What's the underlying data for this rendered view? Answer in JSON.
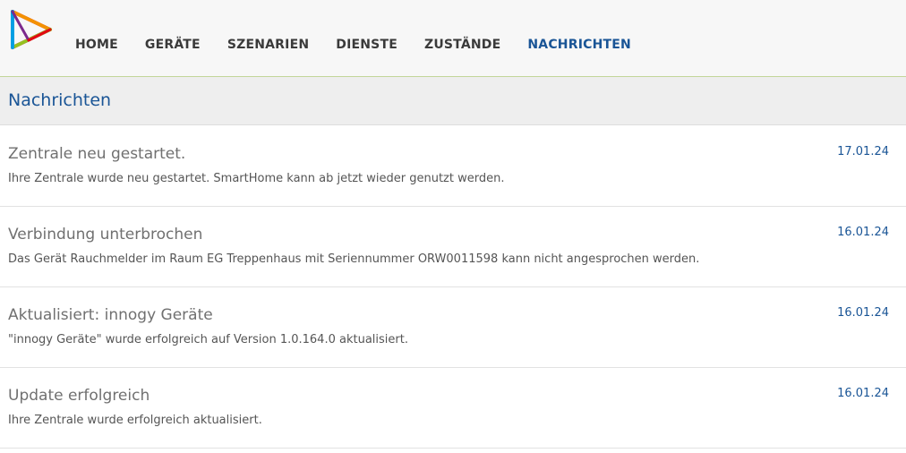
{
  "nav": {
    "items": [
      {
        "label": "HOME",
        "active": false
      },
      {
        "label": "GERÄTE",
        "active": false
      },
      {
        "label": "SZENARIEN",
        "active": false
      },
      {
        "label": "DIENSTE",
        "active": false
      },
      {
        "label": "ZUSTÄNDE",
        "active": false
      },
      {
        "label": "NACHRICHTEN",
        "active": true
      }
    ]
  },
  "page": {
    "title": "Nachrichten"
  },
  "messages": [
    {
      "title": "Zentrale neu gestartet.",
      "body": "Ihre Zentrale wurde neu gestartet. SmartHome kann ab jetzt wieder genutzt werden.",
      "date": "17.01.24"
    },
    {
      "title": "Verbindung unterbrochen",
      "body": "Das Gerät Rauchmelder im Raum EG Treppenhaus mit Seriennummer ORW0011598 kann nicht angesprochen werden.",
      "date": "16.01.24"
    },
    {
      "title": "Aktualisiert: innogy Geräte",
      "body": "\"innogy Geräte\" wurde erfolgreich auf Version 1.0.164.0 aktualisiert.",
      "date": "16.01.24"
    },
    {
      "title": "Update erfolgreich",
      "body": "Ihre Zentrale wurde erfolgreich aktualisiert.",
      "date": "16.01.24"
    }
  ],
  "colors": {
    "accent": "#1a5596",
    "nav_text": "#3a3a3a",
    "header_bg": "#eeeeee",
    "topbar_border": "#c3d69a"
  },
  "icons": {
    "logo": "play-triangle-logo-icon"
  }
}
